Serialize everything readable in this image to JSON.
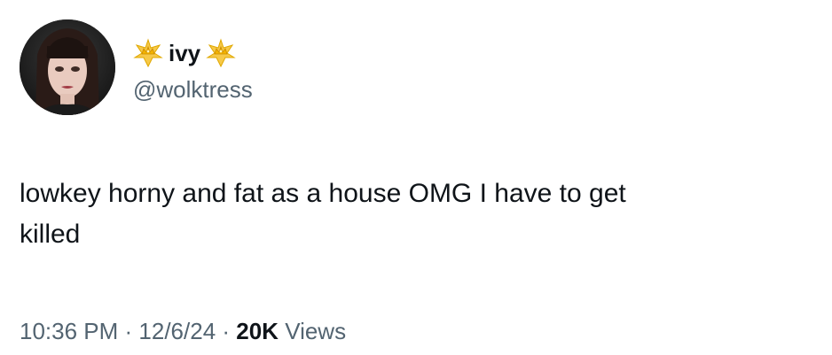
{
  "tweet": {
    "display_name": "ivy",
    "name_prefix_icon": "crown-sparkle-icon",
    "name_suffix_icon": "crown-sparkle-icon",
    "handle": "@wolktress",
    "text": "lowkey horny and fat as a house OMG I have to get\nkilled",
    "time": "10:36 PM",
    "separator": " · ",
    "date": "12/6/24",
    "views_count": "20K",
    "views_label": " Views"
  },
  "colors": {
    "primary_text": "#0f1419",
    "secondary_text": "#536471",
    "background": "#ffffff"
  }
}
